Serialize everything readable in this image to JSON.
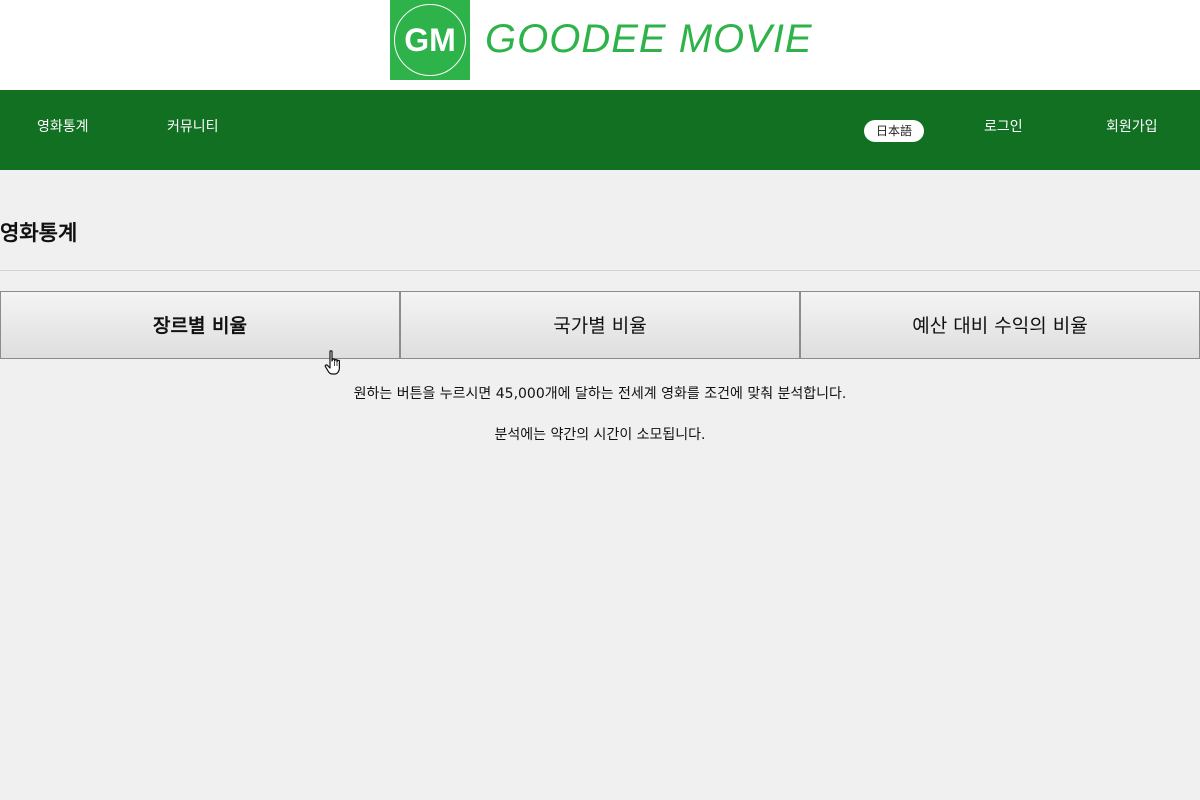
{
  "brand": {
    "logo_letters": "GM",
    "name": "GOODEE MOVIE",
    "color": "#2db34a"
  },
  "nav": {
    "bg_color": "#117022",
    "left_items": [
      "영화통계",
      "커뮤니티"
    ],
    "language_button": "日本語",
    "login": "로그인",
    "signup": "회원가입"
  },
  "page": {
    "title": "영화통계"
  },
  "tabs": [
    {
      "label": "장르별 비율",
      "active": true
    },
    {
      "label": "국가별 비율",
      "active": false
    },
    {
      "label": "예산 대비 수익의 비율",
      "active": false
    }
  ],
  "info": {
    "line1": "원하는 버튼을 누르시면 45,000개에 달하는 전세계 영화를 조건에 맞춰 분석합니다.",
    "line2": "분석에는 약간의 시간이 소모됩니다."
  },
  "icons": {
    "pointer": "hand-pointer-icon"
  }
}
